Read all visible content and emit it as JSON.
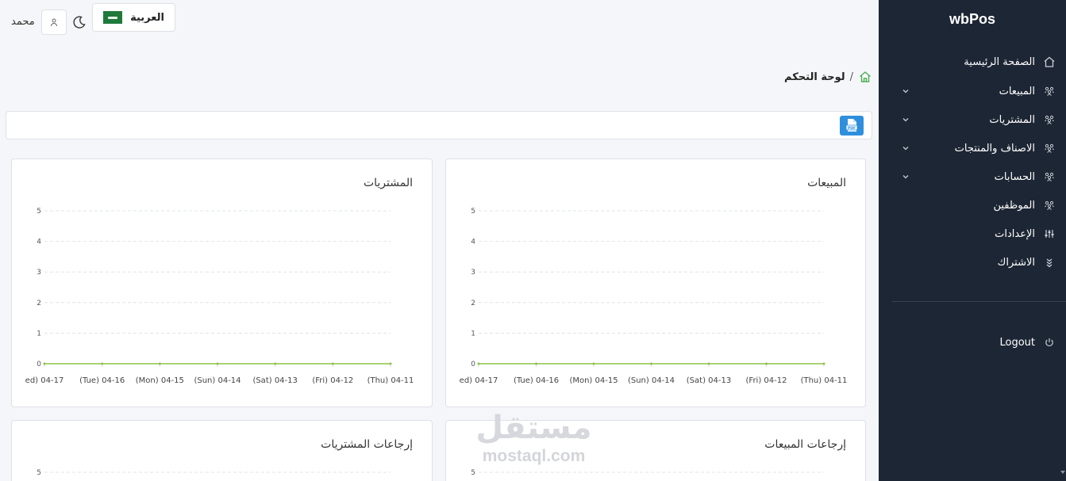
{
  "topbar": {
    "language_label": "العربية",
    "username": "محمد"
  },
  "sidebar": {
    "brand": "wbPos",
    "items": [
      {
        "label": "الصفحة الرئيسية",
        "icon": "home-icon",
        "has_submenu": false
      },
      {
        "label": "المبيعات",
        "icon": "users-icon",
        "has_submenu": true
      },
      {
        "label": "المشتريات",
        "icon": "users-icon",
        "has_submenu": true
      },
      {
        "label": "الاصناف والمنتجات",
        "icon": "users-icon",
        "has_submenu": true
      },
      {
        "label": "الحسابات",
        "icon": "users-icon",
        "has_submenu": true
      },
      {
        "label": "الموظفين",
        "icon": "users-icon",
        "has_submenu": false
      },
      {
        "label": "الإعدادات",
        "icon": "sliders-icon",
        "has_submenu": false
      },
      {
        "label": "الاشتراك",
        "icon": "chevrons-down-icon",
        "has_submenu": false
      }
    ],
    "logout_label": "Logout"
  },
  "breadcrumb": {
    "current": "لوحة التحكم",
    "separator": "/"
  },
  "colors": {
    "sidebar_bg": "#1d2634",
    "accent_green": "#4caf50",
    "pdf_blue": "#2e8fdd",
    "series_line": "#8bc34a"
  },
  "cards": [
    {
      "title": "المبيعات",
      "chart_data": {
        "type": "line",
        "categories": [
          "ed) 04-17",
          "(Tue) 04-16",
          "(Mon) 04-15",
          "(Sun) 04-14",
          "(Sat) 04-13",
          "(Fri) 04-12",
          "(Thu) 04-11"
        ],
        "values": [
          0,
          0,
          0,
          0,
          0,
          0,
          0
        ],
        "y_ticks": [
          "0",
          "1",
          "2",
          "3",
          "4",
          "5"
        ],
        "ylim": [
          0,
          5
        ],
        "grid": true
      }
    },
    {
      "title": "المشتريات",
      "chart_data": {
        "type": "line",
        "categories": [
          "ed) 04-17",
          "(Tue) 04-16",
          "(Mon) 04-15",
          "(Sun) 04-14",
          "(Sat) 04-13",
          "(Fri) 04-12",
          "(Thu) 04-11"
        ],
        "values": [
          0,
          0,
          0,
          0,
          0,
          0,
          0
        ],
        "y_ticks": [
          "0",
          "1",
          "2",
          "3",
          "4",
          "5"
        ],
        "ylim": [
          0,
          5
        ],
        "grid": true
      }
    },
    {
      "title": "إرجاعات المبيعات",
      "chart_data": {
        "type": "line",
        "y_ticks": [
          "5"
        ],
        "ylim": [
          0,
          5
        ],
        "grid": true
      }
    },
    {
      "title": "إرجاعات المشتريات",
      "chart_data": {
        "type": "line",
        "y_ticks": [
          "5"
        ],
        "ylim": [
          0,
          5
        ],
        "grid": true
      }
    }
  ],
  "watermark": {
    "arabic": "مستقل",
    "latin": "mostaql.com"
  }
}
